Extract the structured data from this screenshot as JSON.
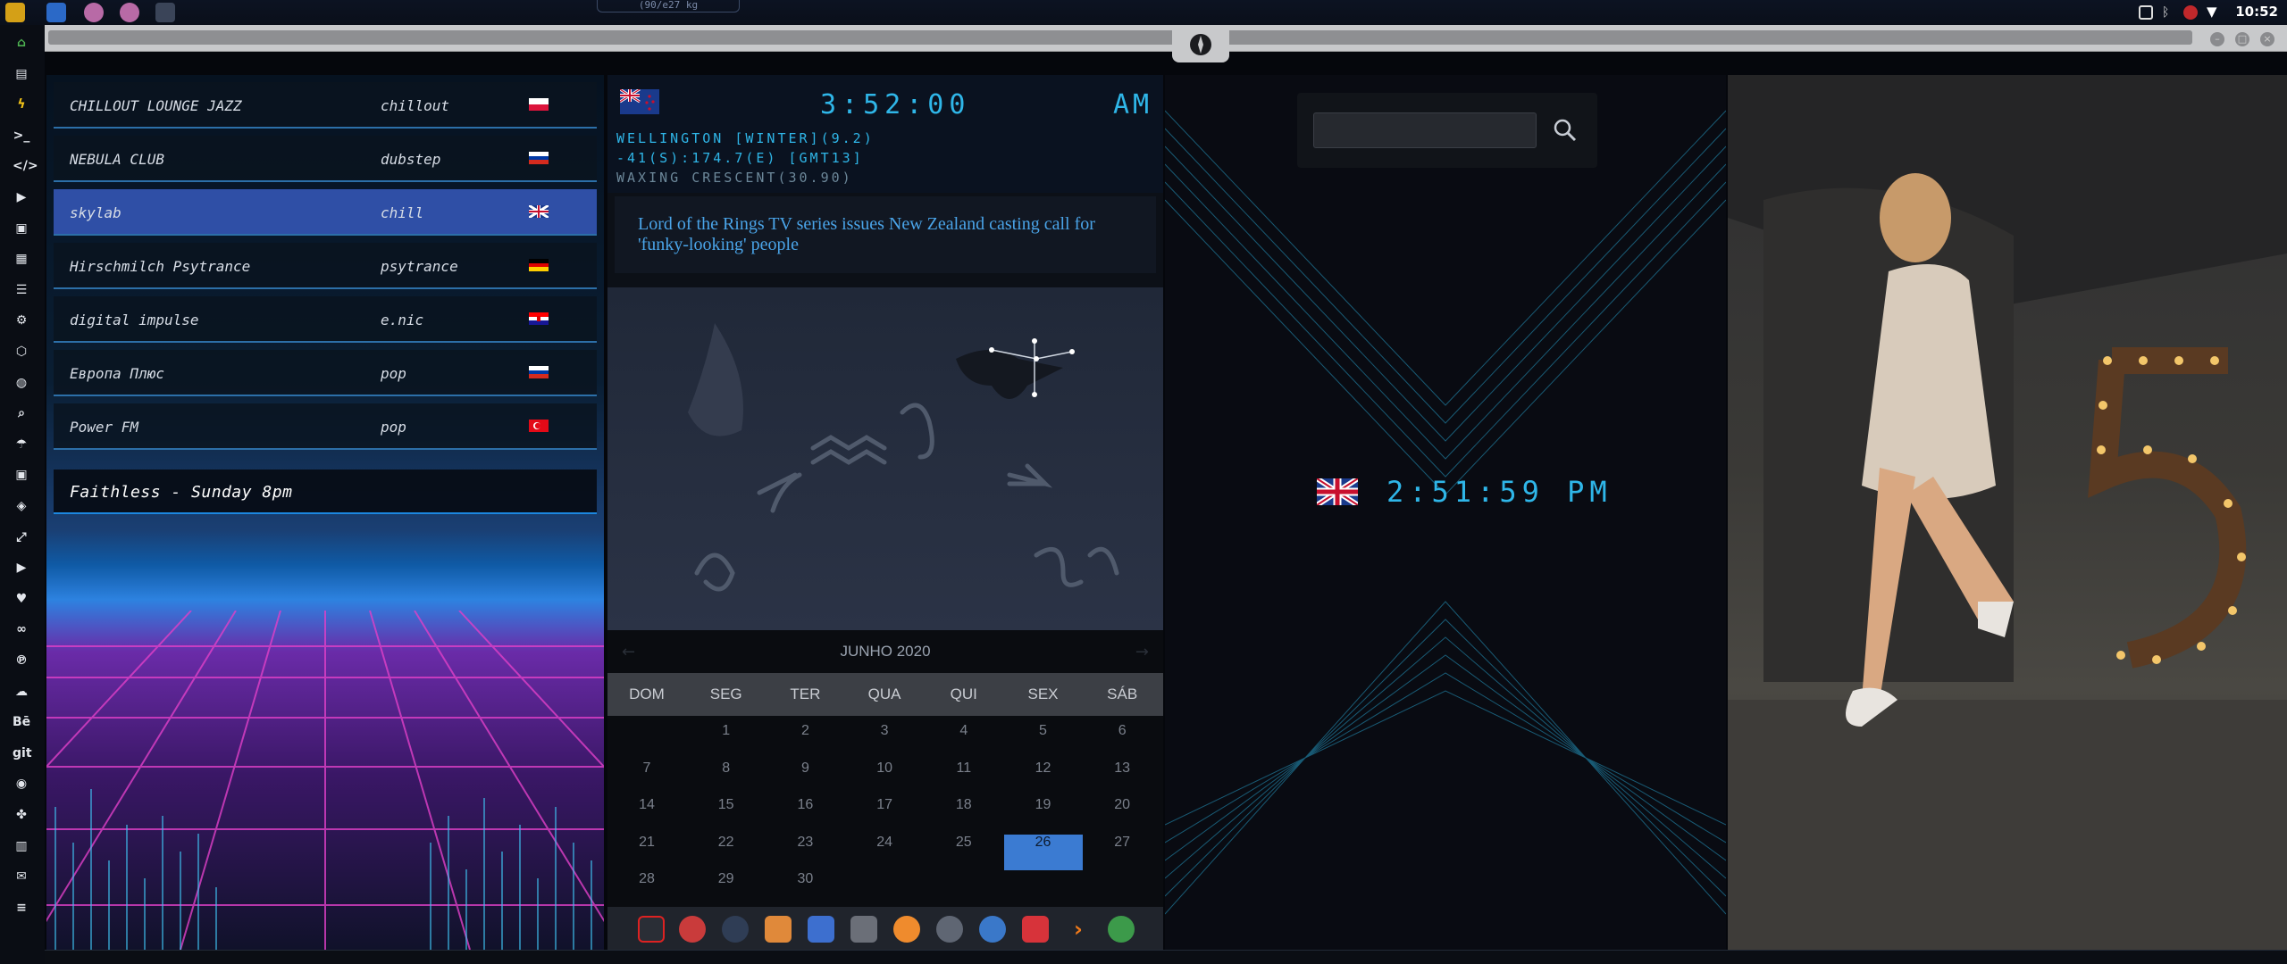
{
  "topbar": {
    "scale_tag": "(90/e27 kg",
    "clock": "10:52"
  },
  "radio": {
    "stations": [
      {
        "name": "CHILLOUT LOUNGE JAZZ",
        "genre": "chillout",
        "flag": "poland-flag",
        "selected": false
      },
      {
        "name": "NEBULA CLUB",
        "genre": "dubstep",
        "flag": "russia-flag",
        "selected": false
      },
      {
        "name": "skylab",
        "genre": "chill",
        "flag": "uk-flag",
        "selected": true
      },
      {
        "name": "Hirschmilch Psytrance",
        "genre": "psytrance",
        "flag": "germany-flag",
        "selected": false
      },
      {
        "name": "digital impulse",
        "genre": "e.nic",
        "flag": "croatia-flag",
        "selected": false
      },
      {
        "name": "Европа Плюс",
        "genre": "pop",
        "flag": "russia-flag",
        "selected": false
      },
      {
        "name": "Power FM",
        "genre": "pop",
        "flag": "turkey-flag",
        "selected": false
      }
    ],
    "now_playing": "Faithless - Sunday 8pm"
  },
  "nz_clock": {
    "time": "3:52:00",
    "ampm": "AM",
    "line1": "WELLINGTON [WINTER](9.2)",
    "line2": "-41(S):174.7(E) [GMT13]",
    "line3": "WAXING CRESCENT(30.90)",
    "flag": "new-zealand-flag"
  },
  "news": {
    "headline": "Lord of the Rings TV series issues New Zealand casting call for 'funky-looking' people"
  },
  "calendar": {
    "month_label": "JUNHO 2020",
    "weekdays": [
      "DOM",
      "SEG",
      "TER",
      "QUA",
      "QUI",
      "SEX",
      "SÁB"
    ],
    "weeks": [
      [
        "",
        "1",
        "2",
        "3",
        "4",
        "5",
        "6"
      ],
      [
        "7",
        "8",
        "9",
        "10",
        "11",
        "12",
        "13"
      ],
      [
        "14",
        "15",
        "16",
        "17",
        "18",
        "19",
        "20"
      ],
      [
        "21",
        "22",
        "23",
        "24",
        "25",
        "26",
        "27"
      ],
      [
        "28",
        "29",
        "30",
        "",
        "",
        "",
        ""
      ]
    ],
    "today": "26"
  },
  "uk_clock": {
    "time": "2:51:59",
    "ampm": "PM",
    "flag": "uk-flag"
  },
  "colors": {
    "accent": "#2fb6e8",
    "selected_row": "#2f4fa6",
    "today": "#3b7bd2"
  },
  "launcher_icons": [
    "home-icon",
    "document-icon",
    "bolt-icon",
    "terminal-icon",
    "code-icon",
    "play-icon",
    "video-icon",
    "image-icon",
    "news-icon",
    "settings-icon",
    "network-icon",
    "globe-icon",
    "search-icon",
    "umbrella-icon",
    "contacts-icon",
    "tags-icon",
    "fullscreen-icon",
    "youtube-icon",
    "heart-icon",
    "link-icon",
    "pinterest-icon",
    "cloud-icon",
    "behance-icon",
    "git-icon",
    "github-icon",
    "puzzle-icon",
    "map-icon",
    "mail-icon",
    "menu-icon"
  ],
  "launcher_text": {
    "behance": "Bē",
    "git": "git"
  }
}
